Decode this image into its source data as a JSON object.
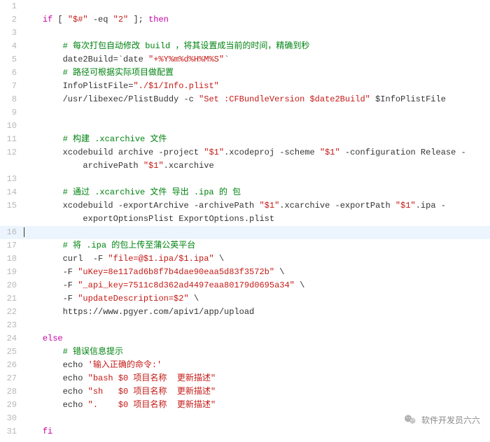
{
  "highlighted_line": 16,
  "footer_label": "软件开发员六六",
  "lines": [
    {
      "n": 1,
      "tokens": []
    },
    {
      "n": 2,
      "indent": 1,
      "tokens": [
        [
          "kw",
          "if"
        ],
        [
          "",
          " [ "
        ],
        [
          "str",
          "\"$#\""
        ],
        [
          "",
          " -eq "
        ],
        [
          "str",
          "\"2\""
        ],
        [
          "",
          " ]; "
        ],
        [
          "kw",
          "then"
        ]
      ]
    },
    {
      "n": 3,
      "tokens": []
    },
    {
      "n": 4,
      "indent": 2,
      "tokens": [
        [
          "cmt",
          "# 每次打包自动修改 build ，将其设置成当前的时间，精确到秒"
        ]
      ]
    },
    {
      "n": 5,
      "indent": 2,
      "tokens": [
        [
          "",
          "date2Build=`date "
        ],
        [
          "str",
          "\"+%Y%m%d%H%M%S\""
        ],
        [
          "",
          "`"
        ]
      ]
    },
    {
      "n": 6,
      "indent": 2,
      "tokens": [
        [
          "cmt",
          "# 路径可根据实际项目做配置"
        ]
      ]
    },
    {
      "n": 7,
      "indent": 2,
      "tokens": [
        [
          "",
          "InfoPlistFile="
        ],
        [
          "str",
          "\"./$1/Info.plist\""
        ]
      ]
    },
    {
      "n": 8,
      "indent": 2,
      "tokens": [
        [
          "",
          "/usr/libexec/PlistBuddy -c "
        ],
        [
          "str",
          "\"Set :CFBundleVersion $date2Build\""
        ],
        [
          "",
          " $InfoPlistFile"
        ]
      ]
    },
    {
      "n": 9,
      "tokens": []
    },
    {
      "n": 10,
      "tokens": []
    },
    {
      "n": 11,
      "indent": 2,
      "tokens": [
        [
          "cmt",
          "# 构建 .xcarchive 文件"
        ]
      ]
    },
    {
      "n": 12,
      "indent": 2,
      "tokens": [
        [
          "",
          "xcodebuild archive -project "
        ],
        [
          "str",
          "\"$1\""
        ],
        [
          "",
          ".xcodeproj -scheme "
        ],
        [
          "str",
          "\"$1\""
        ],
        [
          "",
          " -configuration Release -"
        ]
      ]
    },
    {
      "n": "",
      "indent": 3,
      "tokens": [
        [
          "",
          "archivePath "
        ],
        [
          "str",
          "\"$1\""
        ],
        [
          "",
          ".xcarchive"
        ]
      ]
    },
    {
      "n": 13,
      "tokens": []
    },
    {
      "n": 14,
      "indent": 2,
      "tokens": [
        [
          "cmt",
          "# 通过 .xcarchive 文件 导出 .ipa 的 包"
        ]
      ]
    },
    {
      "n": 15,
      "indent": 2,
      "tokens": [
        [
          "",
          "xcodebuild -exportArchive -archivePath "
        ],
        [
          "str",
          "\"$1\""
        ],
        [
          "",
          ".xcarchive -exportPath "
        ],
        [
          "str",
          "\"$1\""
        ],
        [
          "",
          ".ipa -"
        ]
      ]
    },
    {
      "n": "",
      "indent": 3,
      "tokens": [
        [
          "",
          "exportOptionsPlist ExportOptions.plist"
        ]
      ]
    },
    {
      "n": 16,
      "indent": 0,
      "tokens": [],
      "caret": true
    },
    {
      "n": 17,
      "indent": 2,
      "tokens": [
        [
          "cmt",
          "# 将 .ipa 的包上传至蒲公英平台"
        ]
      ]
    },
    {
      "n": 18,
      "indent": 2,
      "tokens": [
        [
          "",
          "curl  -F "
        ],
        [
          "str",
          "\"file=@$1.ipa/$1.ipa\""
        ],
        [
          "",
          " \\"
        ]
      ]
    },
    {
      "n": 19,
      "indent": 2,
      "tokens": [
        [
          "",
          "-F "
        ],
        [
          "str",
          "\"uKey=8e117ad6b8f7b4dae90eaa5d83f3572b\""
        ],
        [
          "",
          " \\"
        ]
      ]
    },
    {
      "n": 20,
      "indent": 2,
      "tokens": [
        [
          "",
          "-F "
        ],
        [
          "str",
          "\"_api_key=7511c8d362ad4497eaa80179d0695a34\""
        ],
        [
          "",
          " \\"
        ]
      ]
    },
    {
      "n": 21,
      "indent": 2,
      "tokens": [
        [
          "",
          "-F "
        ],
        [
          "str",
          "\"updateDescription=$2\""
        ],
        [
          "",
          " \\"
        ]
      ]
    },
    {
      "n": 22,
      "indent": 2,
      "tokens": [
        [
          "",
          "https://www.pgyer.com/apiv1/app/upload"
        ]
      ]
    },
    {
      "n": 23,
      "tokens": []
    },
    {
      "n": 24,
      "indent": 1,
      "tokens": [
        [
          "kw",
          "else"
        ]
      ]
    },
    {
      "n": 25,
      "indent": 2,
      "tokens": [
        [
          "cmt",
          "# 错误信息提示"
        ]
      ]
    },
    {
      "n": 26,
      "indent": 2,
      "tokens": [
        [
          "",
          "echo "
        ],
        [
          "str",
          "'输入正确的命令:'"
        ]
      ]
    },
    {
      "n": 27,
      "indent": 2,
      "tokens": [
        [
          "",
          "echo "
        ],
        [
          "str",
          "\"bash $0 项目名称  更新描述\""
        ]
      ]
    },
    {
      "n": 28,
      "indent": 2,
      "tokens": [
        [
          "",
          "echo "
        ],
        [
          "str",
          "\"sh   $0 项目名称  更新描述\""
        ]
      ]
    },
    {
      "n": 29,
      "indent": 2,
      "tokens": [
        [
          "",
          "echo "
        ],
        [
          "str",
          "\".    $0 项目名称  更新描述\""
        ]
      ]
    },
    {
      "n": 30,
      "tokens": []
    },
    {
      "n": 31,
      "indent": 1,
      "tokens": [
        [
          "kw",
          "fi"
        ]
      ]
    }
  ]
}
